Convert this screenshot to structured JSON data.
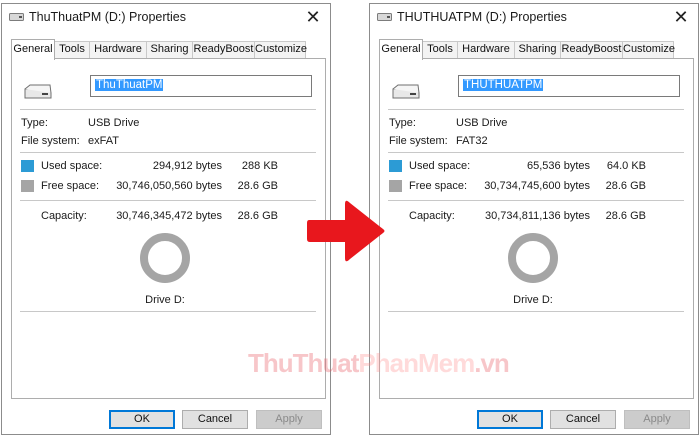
{
  "left_dialog": {
    "title": "ThuThuatPM (D:) Properties",
    "tabs": [
      "General",
      "Tools",
      "Hardware",
      "Sharing",
      "ReadyBoost",
      "Customize"
    ],
    "volume_name": "ThuThuatPM",
    "type_label": "Type:",
    "type_value": "USB Drive",
    "fs_label": "File system:",
    "fs_value": "exFAT",
    "used_label": "Used space:",
    "used_bytes": "294,912 bytes",
    "used_size": "288 KB",
    "free_label": "Free space:",
    "free_bytes": "30,746,050,560 bytes",
    "free_size": "28.6 GB",
    "capacity_label": "Capacity:",
    "capacity_bytes": "30,746,345,472 bytes",
    "capacity_size": "28.6 GB",
    "drive_label": "Drive D:",
    "buttons": {
      "ok": "OK",
      "cancel": "Cancel",
      "apply": "Apply"
    }
  },
  "right_dialog": {
    "title": "THUTHUATPM (D:) Properties",
    "tabs": [
      "General",
      "Tools",
      "Hardware",
      "Sharing",
      "ReadyBoost",
      "Customize"
    ],
    "volume_name": "THUTHUATPM",
    "type_label": "Type:",
    "type_value": "USB Drive",
    "fs_label": "File system:",
    "fs_value": "FAT32",
    "used_label": "Used space:",
    "used_bytes": "65,536 bytes",
    "used_size": "64.0 KB",
    "free_label": "Free space:",
    "free_bytes": "30,734,745,600 bytes",
    "free_size": "28.6 GB",
    "capacity_label": "Capacity:",
    "capacity_bytes": "30,734,811,136 bytes",
    "capacity_size": "28.6 GB",
    "drive_label": "Drive D:",
    "buttons": {
      "ok": "OK",
      "cancel": "Cancel",
      "apply": "Apply"
    }
  },
  "watermark": {
    "part1": "ThuThuat",
    "part2": "PhanMem",
    "part3": ".vn"
  },
  "colors": {
    "used": "#2c9bd5",
    "free": "#a5a5a5",
    "arrow": "#e8171d",
    "accent_button": "#0078d7",
    "selection": "#3399ff"
  },
  "icons": {
    "close": "close-icon",
    "drive": "usb-drive-icon",
    "arrow": "right-arrow-icon"
  }
}
